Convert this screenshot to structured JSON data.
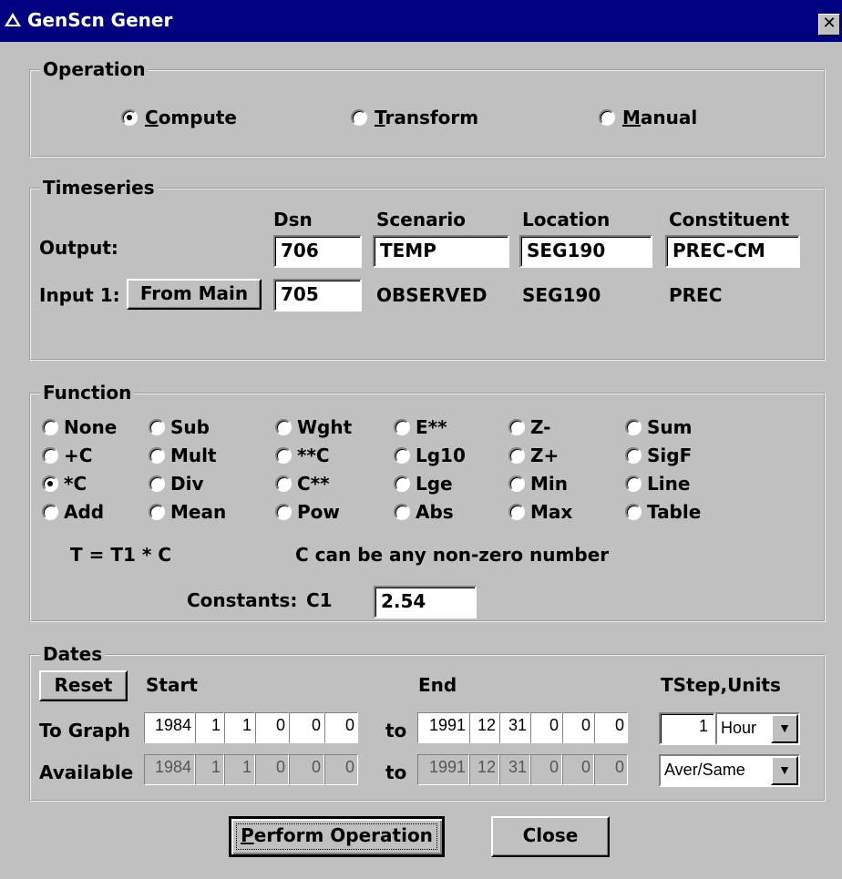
{
  "window": {
    "title": "GenScn Gener",
    "close_glyph": "✕"
  },
  "operation": {
    "legend": "Operation",
    "options": [
      {
        "mnemonic": "C",
        "rest": "ompute",
        "selected": true
      },
      {
        "mnemonic": "T",
        "rest": "ransform",
        "selected": false
      },
      {
        "mnemonic": "M",
        "rest": "anual",
        "selected": false
      }
    ]
  },
  "timeseries": {
    "legend": "Timeseries",
    "headers": {
      "dsn": "Dsn",
      "scenario": "Scenario",
      "location": "Location",
      "constituent": "Constituent"
    },
    "output": {
      "label": "Output:",
      "dsn": "706",
      "scenario": "TEMP",
      "location": "SEG190",
      "constituent": "PREC-CM"
    },
    "input1": {
      "label": "Input 1:",
      "button": "From Main",
      "dsn": "705",
      "scenario": "OBSERVED",
      "location": "SEG190",
      "constituent": "PREC"
    }
  },
  "function": {
    "legend": "Function",
    "options": [
      [
        "None",
        "Sub",
        "Wght",
        "E**",
        "Z-",
        "Sum"
      ],
      [
        "+C",
        "Mult",
        "**C",
        "Lg10",
        "Z+",
        "SigF"
      ],
      [
        "*C",
        "Div",
        "C**",
        "Lge",
        "Min",
        "Line"
      ],
      [
        "Add",
        "Mean",
        "Pow",
        "Abs",
        "Max",
        "Table"
      ]
    ],
    "selected": "*C",
    "formula": "T = T1 * C",
    "hint": "C can be any non-zero number",
    "constants_label": "Constants:",
    "c1_label": "C1",
    "c1_value": "2.54"
  },
  "dates": {
    "legend": "Dates",
    "reset": "Reset",
    "start_label": "Start",
    "end_label": "End",
    "tstep_label": "TStep,Units",
    "to_label": "to",
    "to_graph": {
      "label": "To Graph",
      "start": [
        "1984",
        "1",
        "1",
        "0",
        "0",
        "0"
      ],
      "end": [
        "1991",
        "12",
        "31",
        "0",
        "0",
        "0"
      ]
    },
    "available": {
      "label": "Available",
      "start": [
        "1984",
        "1",
        "1",
        "0",
        "0",
        "0"
      ],
      "end": [
        "1991",
        "12",
        "31",
        "0",
        "0",
        "0"
      ]
    },
    "tstep_value": "1",
    "units_value": "Hour",
    "aggregation_value": "Aver/Same"
  },
  "actions": {
    "perform_mnemonic": "P",
    "perform_rest": "erform Operation",
    "close": "Close"
  }
}
